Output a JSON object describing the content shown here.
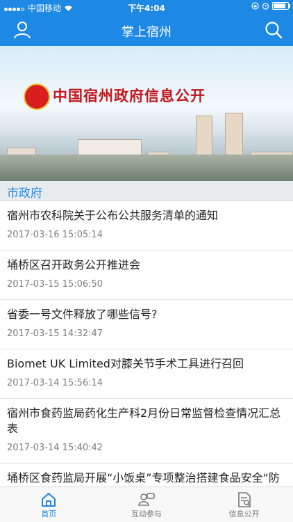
{
  "status_bar": {
    "carrier": "中国移动",
    "time": "下午4:04"
  },
  "nav": {
    "title": "掌上宿州"
  },
  "banner": {
    "text": "中国宿州政府信息公开"
  },
  "section": {
    "title": "市政府"
  },
  "news": [
    {
      "title": "宿州市农科院关于公布公共服务清单的通知",
      "date": "2017-03-16 15:05:14"
    },
    {
      "title": "埇桥区召开政务公开推进会",
      "date": "2017-03-15 15:06:50"
    },
    {
      "title": "省委一号文件释放了哪些信号?",
      "date": "2017-03-15 14:32:47"
    },
    {
      "title": "Biomet UK Limited对膝关节手术工具进行召回",
      "date": "2017-03-14 15:56:14"
    },
    {
      "title": "宿州市食药监局药化生产科2月份日常监督检查情况汇总表",
      "date": "2017-03-14 15:40:42"
    },
    {
      "title": "埇桥区食药监局开展“小饭桌”专项整治搭建食品安全“防护墙”",
      "date": ""
    }
  ],
  "tabs": [
    {
      "label": "首页",
      "icon": "home-icon",
      "active": true
    },
    {
      "label": "互动参与",
      "icon": "interaction-icon",
      "active": false
    },
    {
      "label": "信息公开",
      "icon": "document-icon",
      "active": false
    }
  ],
  "colors": {
    "primary": "#1e88e5",
    "banner_text": "#c3161c"
  }
}
